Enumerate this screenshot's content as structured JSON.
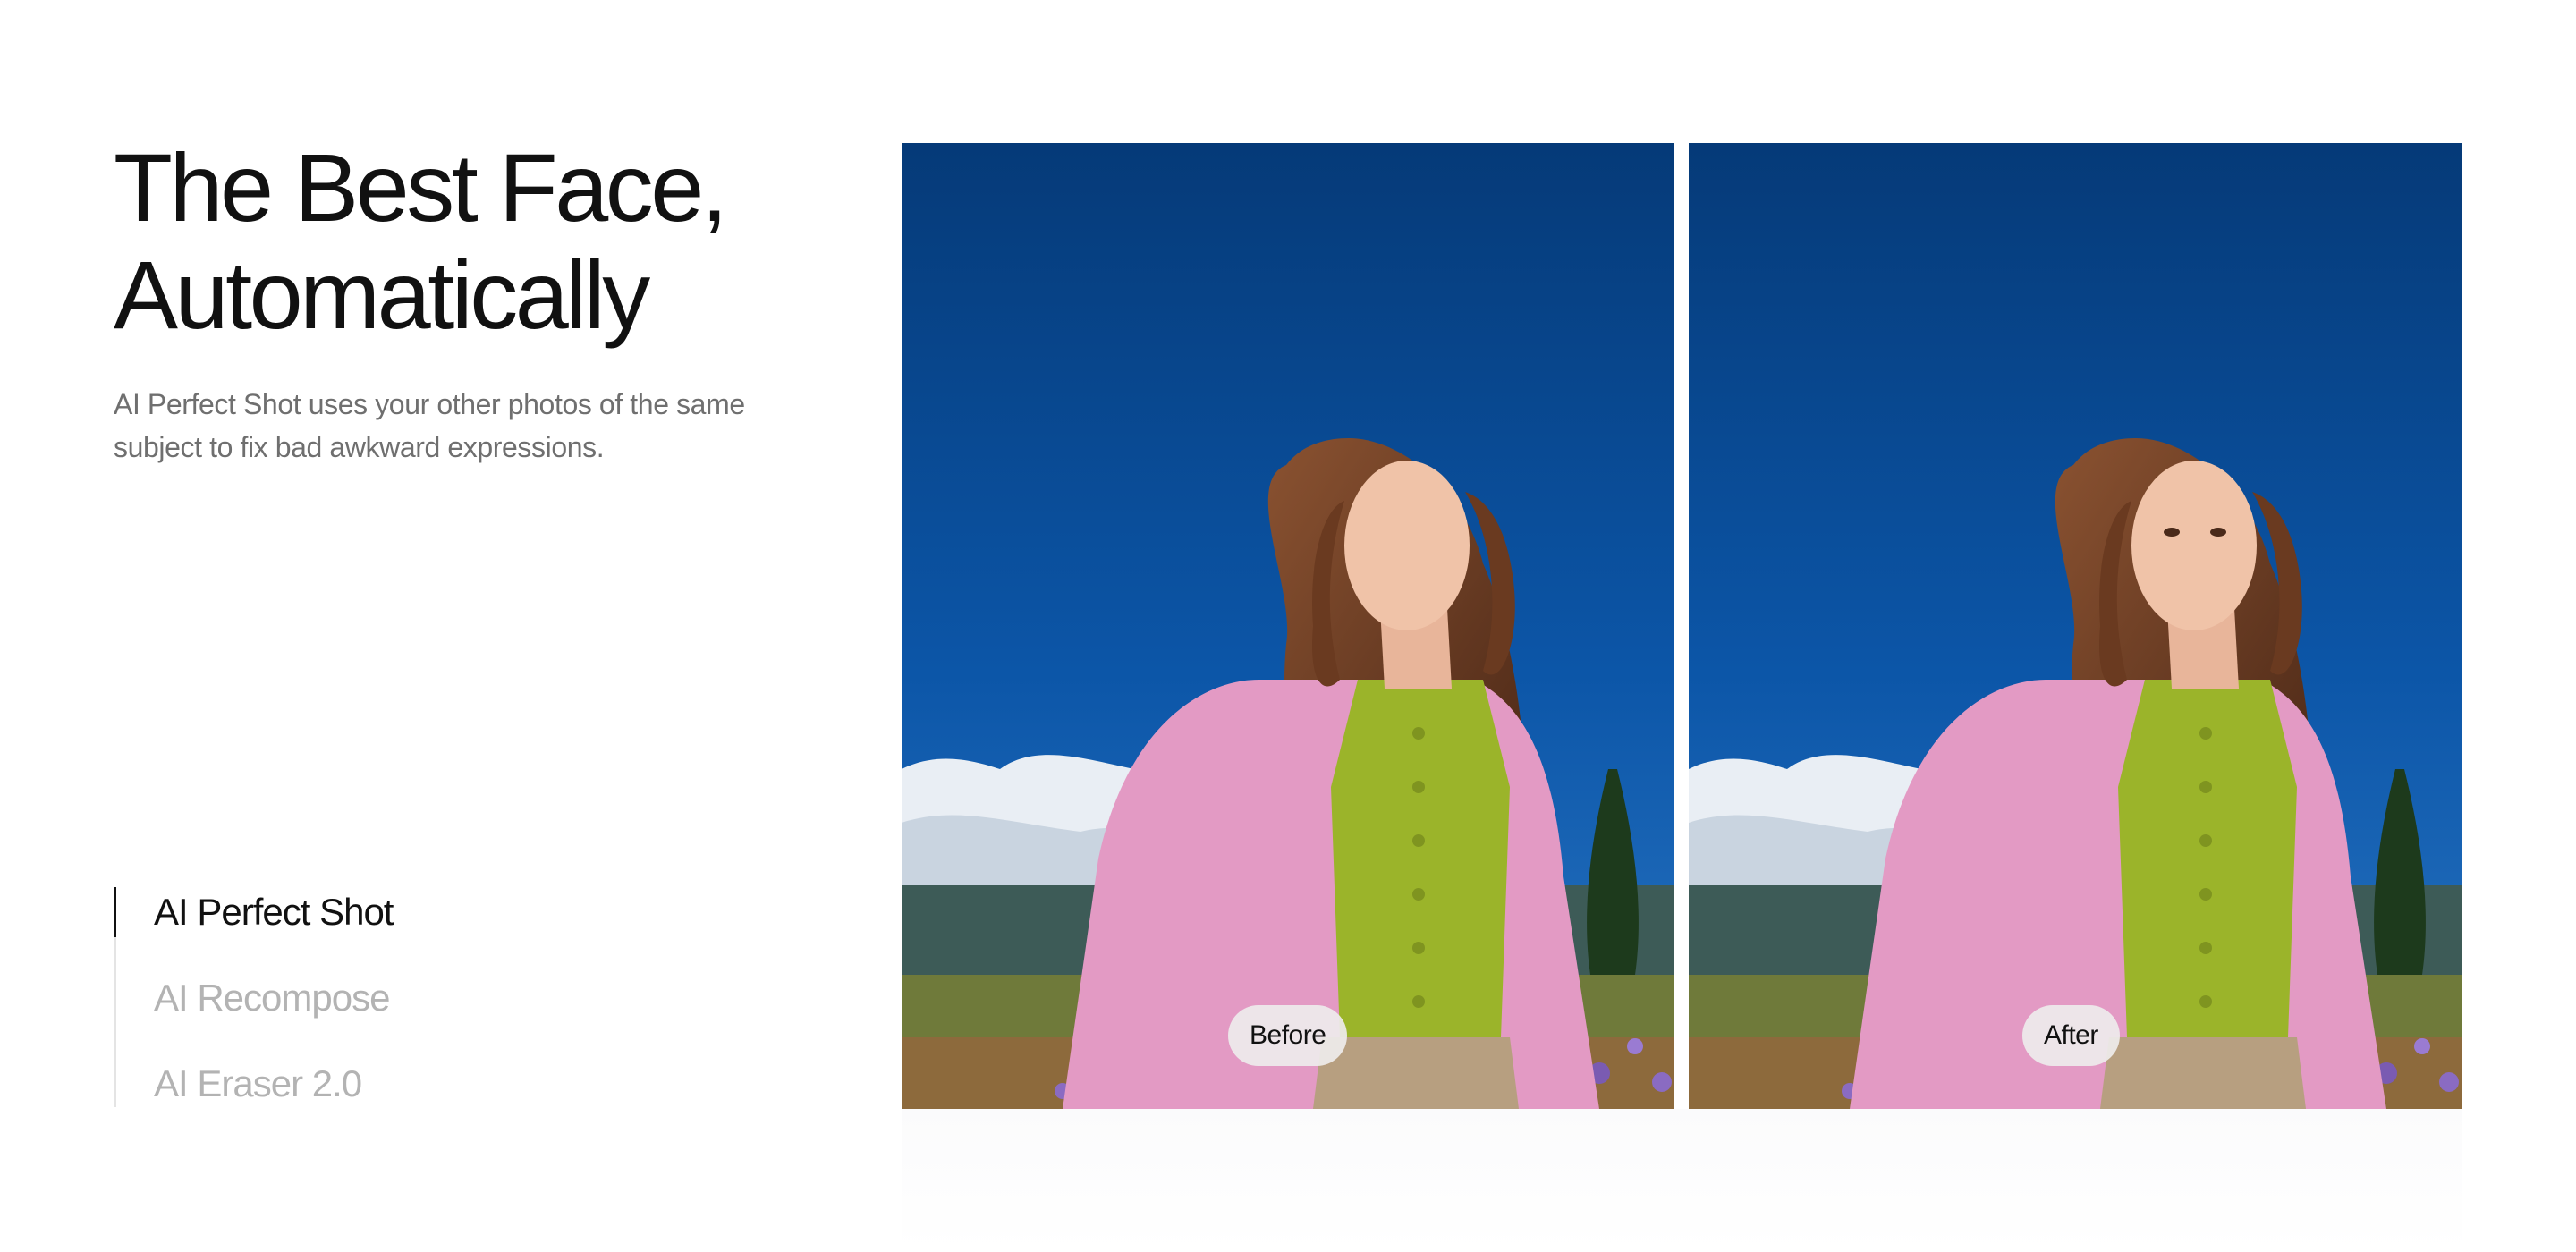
{
  "headline": {
    "line1": "The Best Face,",
    "line2": "Automatically"
  },
  "subtitle": {
    "line1": "AI Perfect Shot uses your other photos of the same",
    "line2": "subject to fix bad awkward expressions."
  },
  "feature_nav": {
    "items": [
      {
        "label": "AI Perfect Shot",
        "active": true
      },
      {
        "label": "AI Recompose",
        "active": false
      },
      {
        "label": "AI Eraser 2.0",
        "active": false
      }
    ]
  },
  "comparison": {
    "before_label": "Before",
    "after_label": "After"
  },
  "colors": {
    "headline": "#111111",
    "subtitle": "#6f6f6f",
    "nav_active": "#111111",
    "nav_inactive": "#b3b3b3",
    "sky_top": "#063d7e",
    "sky_bottom": "#1f6cbf",
    "cardigan": "#e39ac4",
    "top_green": "#9bb42a"
  }
}
